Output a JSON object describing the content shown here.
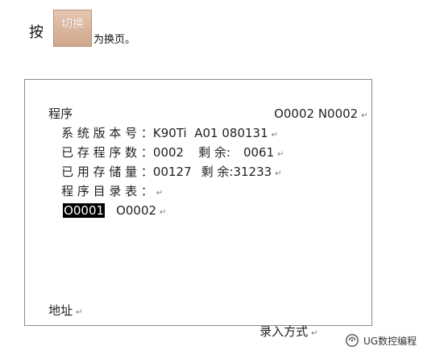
{
  "instruction": {
    "prefix": "按",
    "key_label": "切换",
    "suffix": "为换页。"
  },
  "screen": {
    "title": "程序",
    "header_code": "O0002 N0002",
    "version_label": "系 统 版 本 号 ：",
    "version_value": "K90Ti  A01 080131",
    "stored_label": "已 存 程 序 数 ：",
    "stored_value": "0002",
    "remaining_label": "剩 余:",
    "stored_remaining": "0061",
    "used_label": "已 用 存 储 量 ：",
    "used_value": "00127",
    "used_remaining": "31233",
    "dir_label": "程 序 目 录 表 ：",
    "programs": [
      "O0001",
      "O0002"
    ],
    "address_label": "地址",
    "mode_label": "录入方式",
    "mark": "↵"
  },
  "watermark": {
    "text": "UG数控编程",
    "icon": "wechat-official-account-icon"
  }
}
